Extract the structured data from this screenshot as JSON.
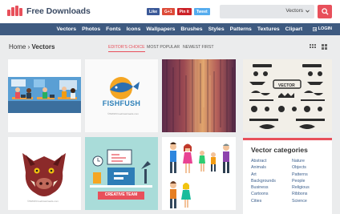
{
  "header": {
    "logo_text": "Free Downloads",
    "social": [
      {
        "label": "Like",
        "color": "#3b5998"
      },
      {
        "label": "G+1",
        "color": "#dd4b39"
      },
      {
        "label": "Pin it",
        "color": "#cb2027"
      },
      {
        "label": "Tweet",
        "color": "#55acee"
      }
    ],
    "search": {
      "category": "Vectors"
    }
  },
  "nav": {
    "items": [
      "Vectors",
      "Photos",
      "Fonts",
      "Icons",
      "Wallpapers",
      "Brushes",
      "Styles",
      "Patterns",
      "Textures",
      "Clipart"
    ],
    "login": "LOGIN"
  },
  "breadcrumb": {
    "home": "Home",
    "separator": "›",
    "current": "Vectors"
  },
  "sort": {
    "editors_choice": "EDITOR'S CHOICE",
    "most_popular": "MOST POPULAR",
    "newest_first": "NEWEST FIRST"
  },
  "cards": {
    "fish_brand": "FISHFUSH",
    "creative_team": "CREATIVE TEAM",
    "credit": "©WWW.FreeDownloads.com",
    "ornament_title": "VECTOR"
  },
  "categories": {
    "title": "Vector categories",
    "col1": [
      "Abstract",
      "Animals",
      "Art",
      "Backgrounds",
      "Business",
      "Cartoons",
      "Cities"
    ],
    "col2": [
      "Nature",
      "Objects",
      "Patterns",
      "People",
      "Religious",
      "Ribbons",
      "Science"
    ]
  },
  "colors": {
    "accent": "#e8505b",
    "nav": "#3e5a80",
    "logo": "#3a4a63"
  }
}
